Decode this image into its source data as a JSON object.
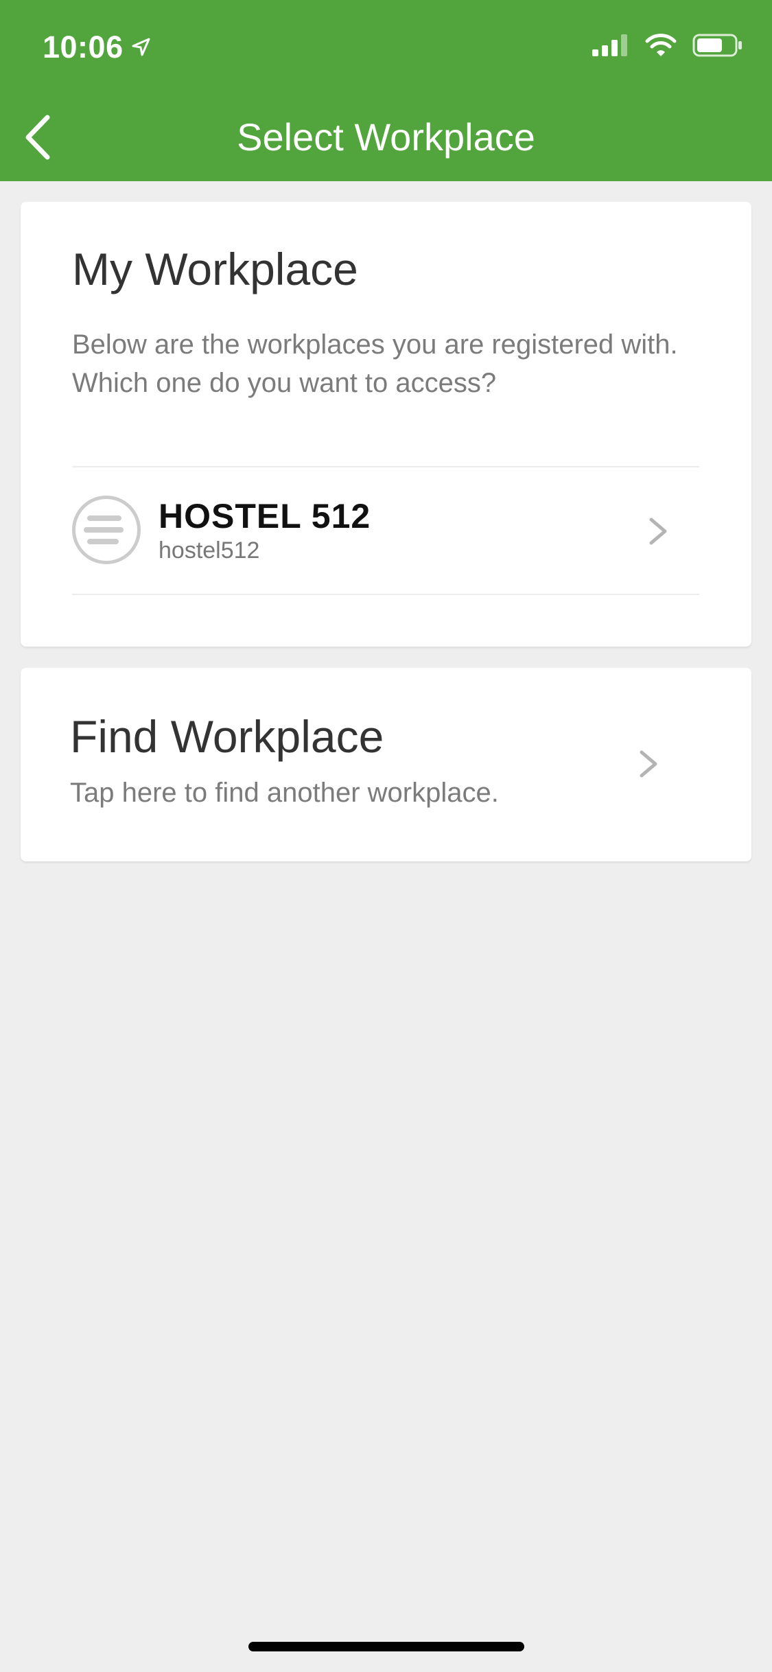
{
  "status_bar": {
    "time": "10:06"
  },
  "nav": {
    "title": "Select Workplace"
  },
  "my_workplace": {
    "title": "My Workplace",
    "description": "Below are the workplaces you are registered with. Which one do you want to access?",
    "items": [
      {
        "name": "HOSTEL 512",
        "slug": "hostel512"
      }
    ]
  },
  "find_workplace": {
    "title": "Find Workplace",
    "description": "Tap here to find another workplace."
  },
  "colors": {
    "header": "#52a43c",
    "background": "#eeeeee"
  }
}
